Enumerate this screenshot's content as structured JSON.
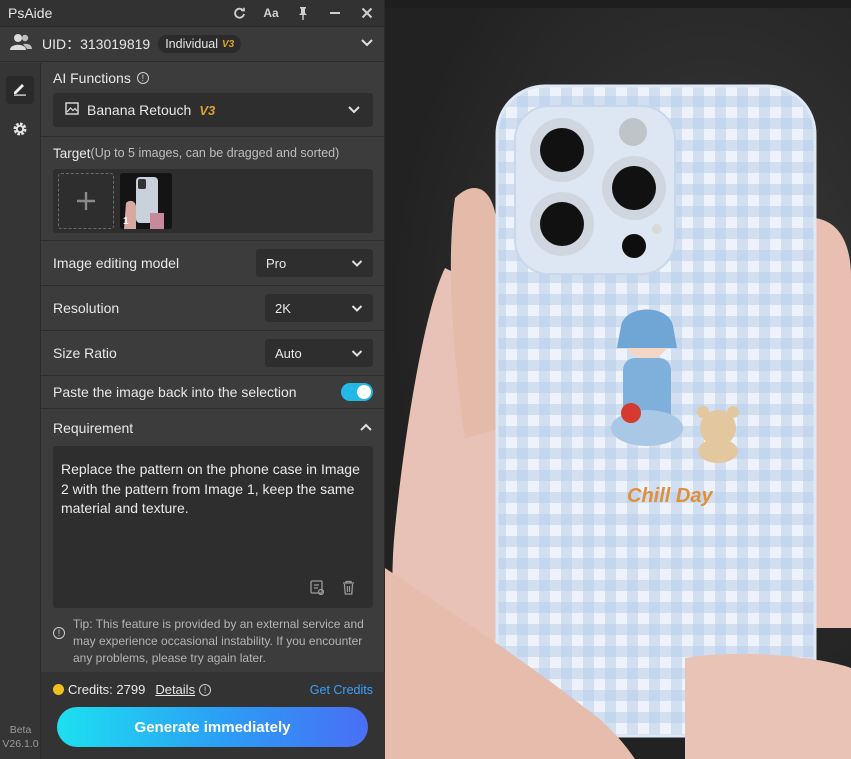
{
  "app": {
    "title": "PsAide"
  },
  "titlebar": {
    "refresh_icon": "refresh-icon",
    "font_icon_label": "Aa",
    "pin_icon": "pin-icon",
    "minimize_icon": "minimize-icon",
    "close_icon": "close-icon"
  },
  "user": {
    "uid_label": "UID：313019819",
    "plan": "Individual",
    "plan_version": "V3"
  },
  "sidebar": {
    "items": [
      {
        "icon": "edit-icon",
        "active": true
      },
      {
        "icon": "gear-icon",
        "active": false
      }
    ],
    "beta_label": "Beta",
    "version": "V26.1.0"
  },
  "ai_functions": {
    "label": "AI Functions",
    "selected": "Banana Retouch",
    "selected_version": "V3"
  },
  "target": {
    "label": "Target",
    "hint": "(Up to 5 images, can be dragged and sorted)",
    "thumbnails": [
      {
        "index": "1"
      }
    ]
  },
  "settings": {
    "model": {
      "label": "Image editing model",
      "value": "Pro"
    },
    "resolution": {
      "label": "Resolution",
      "value": "2K"
    },
    "ratio": {
      "label": "Size Ratio",
      "value": "Auto"
    },
    "paste_back": {
      "label": "Paste the image back into the selection",
      "enabled": true
    }
  },
  "requirement": {
    "label": "Requirement",
    "text": "Replace the pattern on the phone case in Image 2 with the pattern from Image 1, keep the same material and texture.",
    "tip": "Tip: This feature is provided by an external service and may experience occasional instability. If you encounter any problems, please try again later."
  },
  "footer": {
    "credits_label": "Credits: 2799",
    "details_label": "Details",
    "get_credits_label": "Get Credits",
    "generate_label": "Generate immediately"
  },
  "canvas": {
    "phone_text": "Chill Day"
  },
  "colors": {
    "accent": "#22b8e8",
    "link": "#3aa0ff",
    "badge_gold": "#e0a030",
    "panel_bg": "#3c3c3c"
  }
}
